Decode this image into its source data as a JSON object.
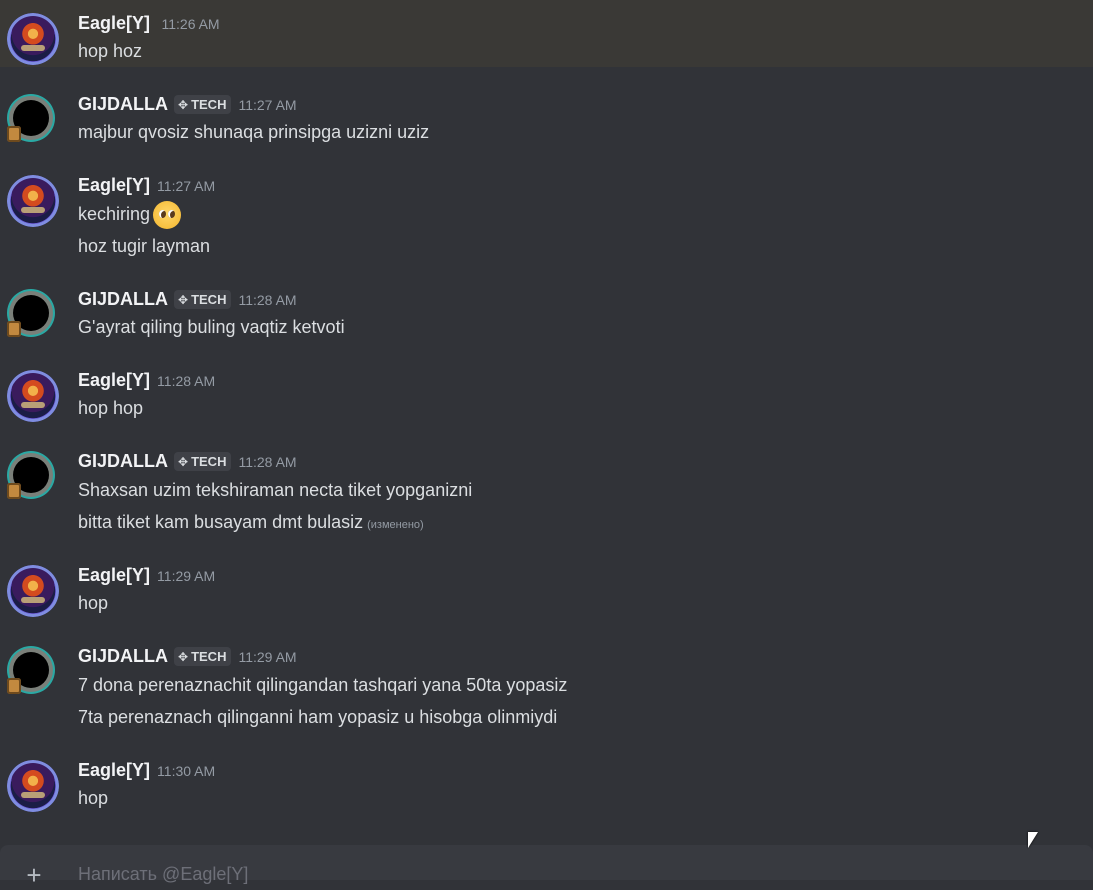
{
  "top_message": {
    "author": "Eagle[Y]",
    "time": "11:26 AM",
    "text": "hop hoz"
  },
  "messages": [
    {
      "author": "GIJDALLA",
      "tag": "TECH",
      "time": "11:27 AM",
      "lines": [
        "majbur qvosiz shunaqa prinsipga uzizni uziz"
      ]
    },
    {
      "author": "Eagle[Y]",
      "time": "11:27 AM",
      "lines": [
        "kechiring",
        "hoz tugir layman"
      ],
      "emoji": "pleading-face"
    },
    {
      "author": "GIJDALLA",
      "tag": "TECH",
      "time": "11:28 AM",
      "lines": [
        "G'ayrat qiling buling vaqtiz ketvoti"
      ]
    },
    {
      "author": "Eagle[Y]",
      "time": "11:28 AM",
      "lines": [
        "hop hop"
      ]
    },
    {
      "author": "GIJDALLA",
      "tag": "TECH",
      "time": "11:28 AM",
      "lines": [
        "Shaxsan uzim tekshiraman necta tiket yopganizni",
        "bitta tiket kam busayam dmt bulasiz"
      ],
      "edited": "(изменено)"
    },
    {
      "author": "Eagle[Y]",
      "time": "11:29 AM",
      "lines": [
        "hop"
      ]
    },
    {
      "author": "GIJDALLA",
      "tag": "TECH",
      "time": "11:29 AM",
      "lines": [
        "7 dona perenaznachit qilingandan tashqari yana 50ta yopasiz",
        "7ta perenaznach qilinganni ham yopasiz u hisobga olinmiydi"
      ]
    },
    {
      "author": "Eagle[Y]",
      "time": "11:30 AM",
      "lines": [
        "hop"
      ]
    }
  ],
  "composer": {
    "placeholder": "Написать @Eagle[Y]",
    "plus_icon": "plus-circle-icon"
  },
  "colors": {
    "background": "#313338",
    "highlight_row": "#3a3936",
    "username": "#f2f3f5",
    "timestamp": "#949ba4",
    "text": "#dbdee1"
  }
}
